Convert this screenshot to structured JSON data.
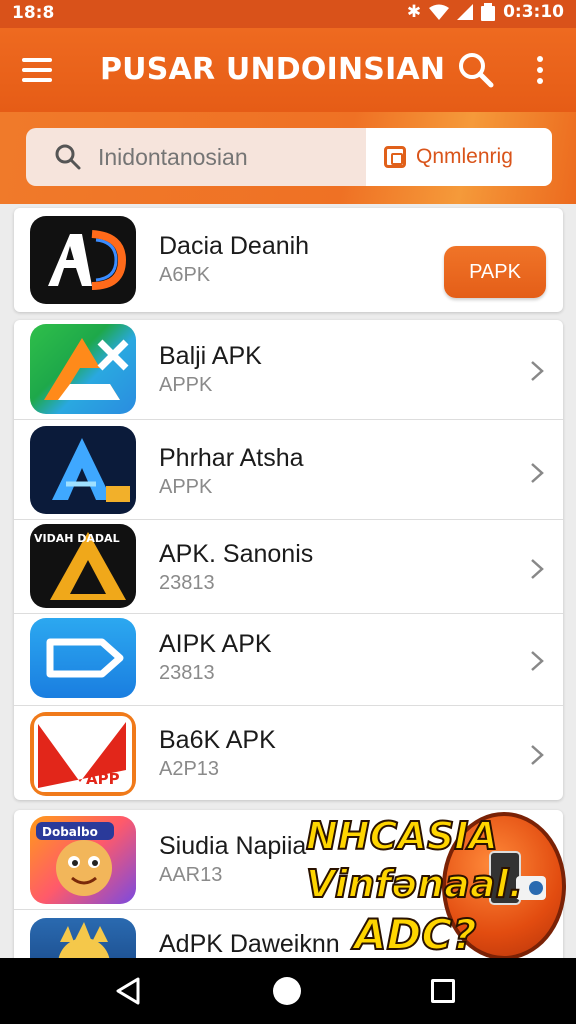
{
  "status_bar": {
    "time": "18:8",
    "clock": "0:3:10"
  },
  "app_bar": {
    "title": "PUSAR UNDOINSIAN"
  },
  "search": {
    "placeholder": "Inidontanosian",
    "filter_label": "Qnmlenrig"
  },
  "apps": [
    {
      "name": "Dacia Deanih",
      "sub": "A6PK",
      "action": "PAPK",
      "icon": "ad-logo-icon"
    },
    {
      "name": "Balji APK",
      "sub": "APPK",
      "icon": "triangle-x-logo-icon"
    },
    {
      "name": "Phrhar Atsha",
      "sub": "APPK",
      "icon": "blue-a-logo-icon"
    },
    {
      "name": "APK. Sanonis",
      "sub": "23813",
      "icon": "gold-triangle-logo-icon",
      "icon_text": "VIDAH DADAL"
    },
    {
      "name": "AIPK APK",
      "sub": "23813",
      "icon": "blue-tag-icon"
    },
    {
      "name": "Ba6K APK",
      "sub": "A2P13",
      "icon": "red-paper-logo-icon",
      "icon_text": "APP"
    },
    {
      "name": "Siudia Napiia",
      "sub": "AAR13",
      "icon": "cartoon-face-icon",
      "icon_text": "Dobalbo"
    },
    {
      "name": "AdPK Daweiknn",
      "sub": "",
      "icon": "sun-face-icon"
    }
  ],
  "promo": {
    "line1": "NHCASIA",
    "line2": "Vinfənaal.",
    "line3": "ADC?"
  },
  "colors": {
    "primary": "#e8621a",
    "accent": "#f07428",
    "background": "#ececec"
  }
}
